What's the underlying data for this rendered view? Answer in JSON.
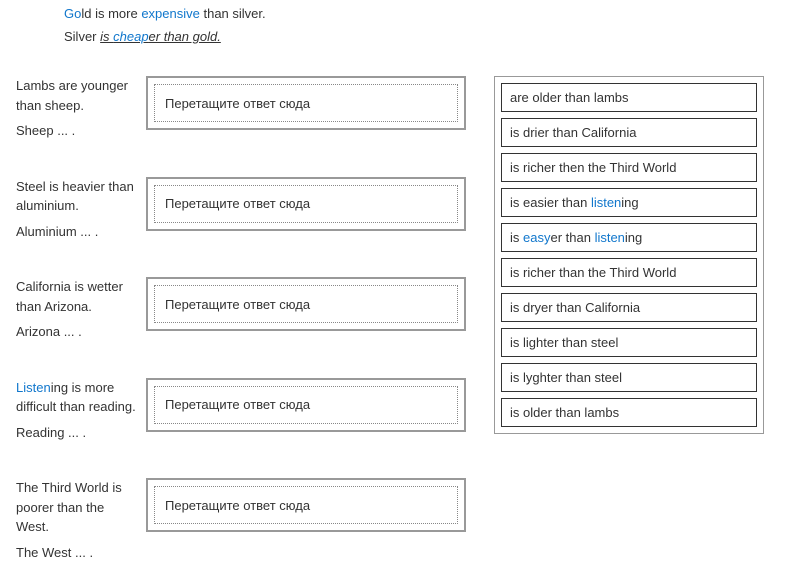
{
  "examples": {
    "line1": {
      "pre": "Go",
      "mid1": "ld is more ",
      "em": "expensive",
      "post": " than silver."
    },
    "line2": {
      "pre": "Silver ",
      "ans_pre": "is ",
      "ans_blue": "cheap",
      "ans_post": "er than gold."
    }
  },
  "questions": [
    {
      "sentence": "Lambs are younger than sheep.",
      "subject": "Sheep ... ."
    },
    {
      "sentence": "Steel is heavier than aluminium.",
      "subject": "Aluminium ... ."
    },
    {
      "sentence": "California is wetter than Arizona.",
      "subject": "Arizona ... ."
    },
    {
      "sentence_pre": "Listen",
      "sentence_post": "ing is more difficult than reading.",
      "subject": "Reading ... ."
    },
    {
      "sentence": "The Third World is poorer than the West.",
      "subject": "The West ... ."
    }
  ],
  "dropzone_placeholder": "Перетащите ответ сюда",
  "options": [
    {
      "text": "are older than lambs"
    },
    {
      "text": "is drier than California"
    },
    {
      "text": "is richer then the Third World"
    },
    {
      "pre": "is easier than ",
      "blue": "listen",
      "post": "ing"
    },
    {
      "pre": "is ",
      "blue": "easy",
      "mid": "er than ",
      "blue2": "listen",
      "post": "ing"
    },
    {
      "text": "is richer than the Third World"
    },
    {
      "text": "is dryer than California"
    },
    {
      "text": "is lighter than steel"
    },
    {
      "text": "is lyghter than steel"
    },
    {
      "text": "is older than lambs"
    }
  ]
}
